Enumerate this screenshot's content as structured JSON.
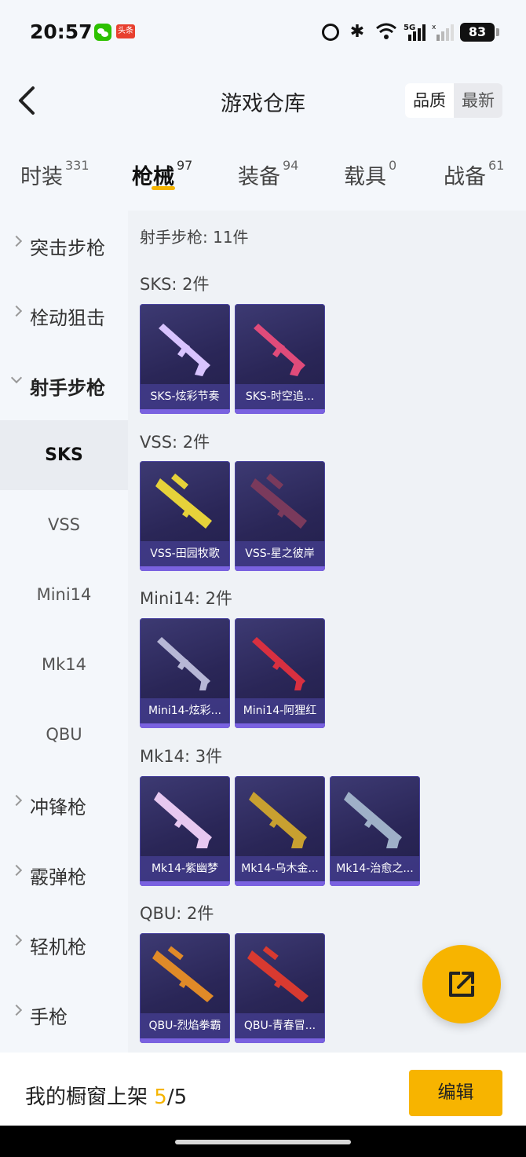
{
  "status_bar": {
    "time": "20:57",
    "toutiao_badge": "头条",
    "battery": "83",
    "network": "5G"
  },
  "header": {
    "title": "游戏仓库",
    "sort_options": [
      "品质",
      "最新"
    ],
    "sort_selected": "品质"
  },
  "tabs": [
    {
      "label": "时装",
      "count": "331"
    },
    {
      "label": "枪械",
      "count": "97",
      "active": true
    },
    {
      "label": "装备",
      "count": "94"
    },
    {
      "label": "载具",
      "count": "0"
    },
    {
      "label": "战备",
      "count": "61"
    }
  ],
  "sidebar": {
    "categories": [
      {
        "label": "突击步枪"
      },
      {
        "label": "栓动狙击"
      },
      {
        "label": "射手步枪",
        "expanded": true
      }
    ],
    "subitems": [
      {
        "label": "SKS",
        "active": true
      },
      {
        "label": "VSS"
      },
      {
        "label": "Mini14"
      },
      {
        "label": "Mk14"
      },
      {
        "label": "QBU"
      }
    ],
    "more_categories": [
      {
        "label": "冲锋枪"
      },
      {
        "label": "霰弹枪"
      },
      {
        "label": "轻机枪"
      },
      {
        "label": "手枪"
      }
    ]
  },
  "content": {
    "summary": "射手步枪: 11件",
    "groups": [
      {
        "title": "SKS: 2件",
        "items": [
          {
            "name": "SKS-炫彩节奏",
            "color": "#d8c3ff"
          },
          {
            "name": "SKS-时空追...",
            "color": "#e04b7a"
          }
        ]
      },
      {
        "title": "VSS: 2件",
        "items": [
          {
            "name": "VSS-田园牧歌",
            "color": "#e6d23a"
          },
          {
            "name": "VSS-星之彼岸",
            "color": "#7a3a5c"
          }
        ]
      },
      {
        "title": "Mini14: 2件",
        "items": [
          {
            "name": "Mini14-炫彩...",
            "color": "#b7b7d6"
          },
          {
            "name": "Mini14-阿狸红",
            "color": "#d83040"
          }
        ]
      },
      {
        "title": "Mk14: 3件",
        "items": [
          {
            "name": "Mk14-紫幽梦",
            "color": "#e7c8f0"
          },
          {
            "name": "Mk14-乌木金...",
            "color": "#c8a030"
          },
          {
            "name": "Mk14-治愈之...",
            "color": "#9fb0c8"
          }
        ]
      },
      {
        "title": "QBU: 2件",
        "items": [
          {
            "name": "QBU-烈焰拳霸",
            "color": "#e08a28"
          },
          {
            "name": "QBU-青春冒...",
            "color": "#d83a30"
          }
        ]
      }
    ]
  },
  "bottom": {
    "showcase_label": "我的橱窗上架 ",
    "showcase_current": "5",
    "showcase_total": "/5",
    "edit_label": "编辑"
  },
  "colors": {
    "accent": "#f7b400",
    "card_bg": "#2a2657",
    "card_bar": "#7a62e0"
  }
}
